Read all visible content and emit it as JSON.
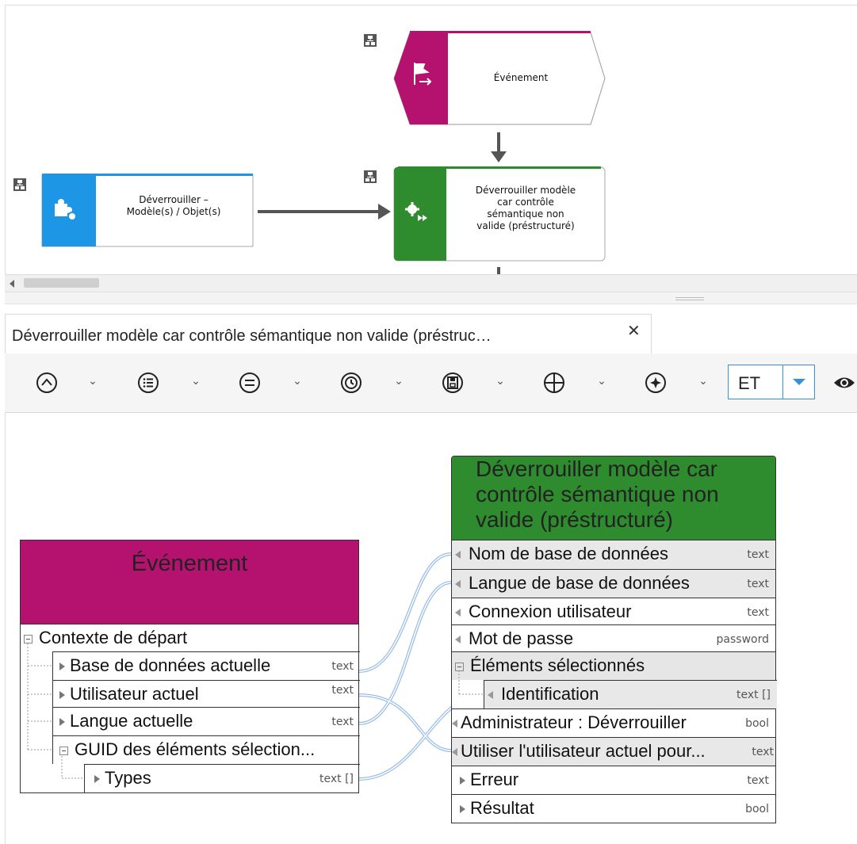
{
  "canvas": {
    "event_label": "Événement",
    "unlock_label": "Déverrouiller –\nModèle(s) / Objet(s)",
    "function_label": "Déverrouiller modèle\ncar contrôle\nsémantique non\nvalide (préstructuré)",
    "colors": {
      "event": "#b5126f",
      "function": "#2e8b2e",
      "unlock": "#1e96e6"
    }
  },
  "tab": {
    "title": "Déverrouiller modèle car contrôle sémantique non valide (préstruc…",
    "close_symbol": "✕"
  },
  "toolbar": {
    "operator_value": "ET",
    "icons": [
      "caret-up-circle-icon",
      "list-circle-icon",
      "equals-circle-icon",
      "clock-circle-icon",
      "save-circle-icon",
      "plus-circle-icon",
      "sparkle-circle-icon"
    ]
  },
  "source_node": {
    "title": "Événement",
    "rows": [
      {
        "label": "Contexte de départ",
        "type": ""
      },
      {
        "label": "Base de données actuelle",
        "type": "text"
      },
      {
        "label": "Utilisateur actuel",
        "type": "text"
      },
      {
        "label": "Langue actuelle",
        "type": "text"
      },
      {
        "label": "GUID des éléments sélection...",
        "type": ""
      },
      {
        "label": "Types",
        "type": "text []"
      }
    ]
  },
  "target_node": {
    "title": "Déverrouiller modèle car\ncontrôle sémantique non\nvalide (préstructuré)",
    "rows": [
      {
        "label": "Nom de base de données",
        "type": "text"
      },
      {
        "label": "Langue de base de données",
        "type": "text"
      },
      {
        "label": "Connexion utilisateur",
        "type": "text"
      },
      {
        "label": "Mot de passe",
        "type": "password"
      },
      {
        "label": "Éléments sélectionnés",
        "type": ""
      },
      {
        "label": "Identification",
        "type": "text []"
      },
      {
        "label": "Administrateur : Déverrouiller",
        "type": "bool"
      },
      {
        "label": "Utiliser l'utilisateur actuel pour...",
        "type": "text"
      },
      {
        "label": "Erreur",
        "type": "text"
      },
      {
        "label": "Résultat",
        "type": "bool"
      }
    ]
  }
}
